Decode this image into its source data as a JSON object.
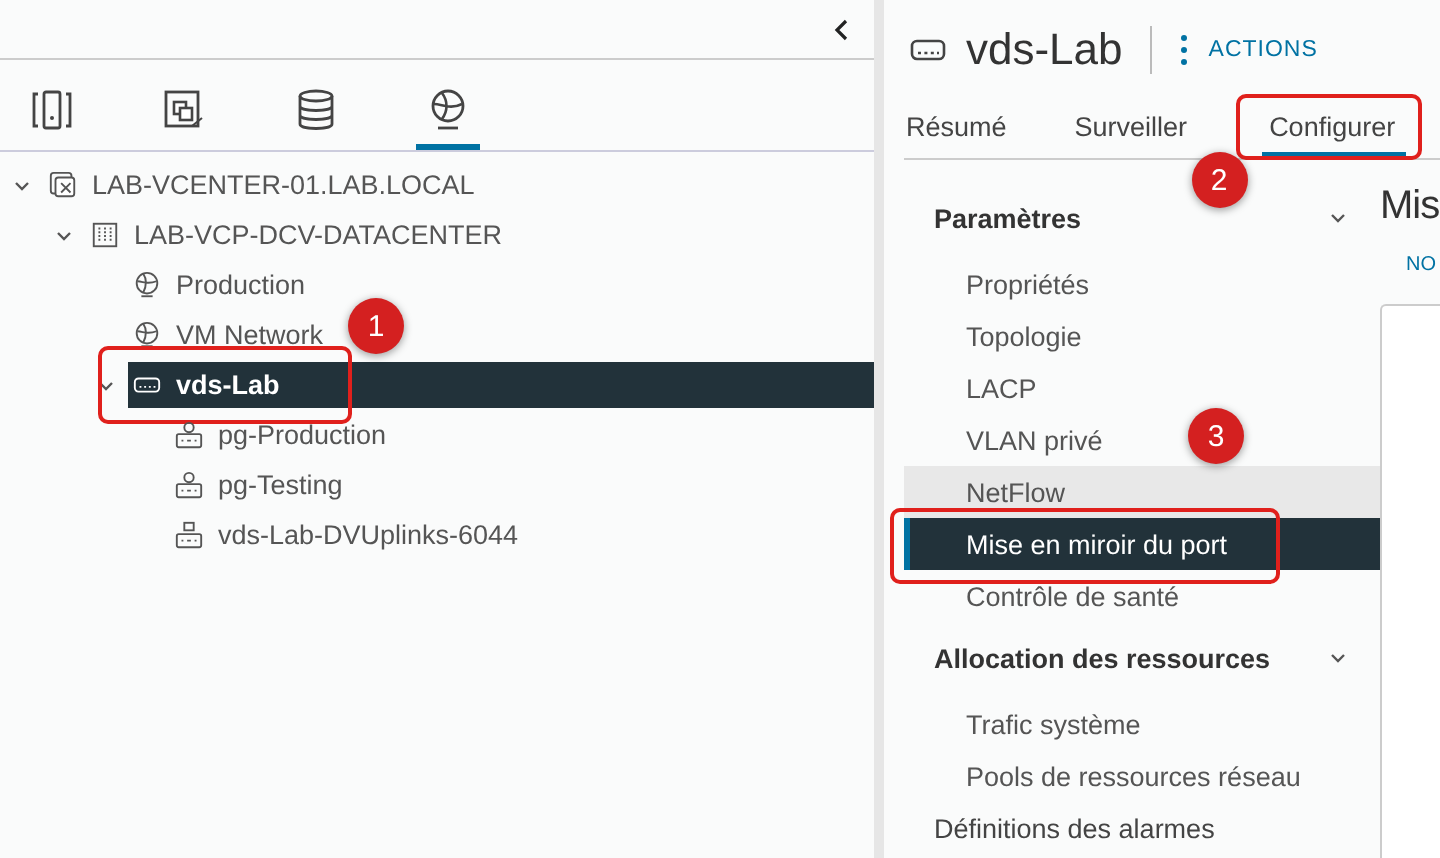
{
  "left_panel": {
    "view_tabs": [
      {
        "kind": "hosts",
        "selected": false
      },
      {
        "kind": "vms",
        "selected": false
      },
      {
        "kind": "storage",
        "selected": false
      },
      {
        "kind": "network",
        "selected": true
      }
    ],
    "tree": [
      {
        "label": "LAB-VCENTER-01.LAB.LOCAL",
        "kind": "vcenter",
        "expanded": true,
        "selected": false,
        "children": [
          {
            "label": "LAB-VCP-DCV-DATACENTER",
            "kind": "datacenter",
            "expanded": true,
            "selected": false,
            "children": [
              {
                "label": "Production",
                "kind": "network",
                "selected": false
              },
              {
                "label": "VM Network",
                "kind": "network",
                "selected": false
              },
              {
                "label": "vds-Lab",
                "kind": "vds",
                "expanded": true,
                "selected": true,
                "callout": "1",
                "children": [
                  {
                    "label": "pg-Production",
                    "kind": "portgroup",
                    "selected": false
                  },
                  {
                    "label": "pg-Testing",
                    "kind": "portgroup",
                    "selected": false
                  },
                  {
                    "label": "vds-Lab-DVUplinks-6044",
                    "kind": "uplink",
                    "selected": false
                  }
                ]
              }
            ]
          }
        ]
      }
    ]
  },
  "right_panel": {
    "title": "vds-Lab",
    "actions_label": "ACTIONS",
    "tabs": [
      {
        "label": "Résumé",
        "selected": false
      },
      {
        "label": "Surveiller",
        "selected": false
      },
      {
        "label": "Configurer",
        "selected": true,
        "callout": "2"
      }
    ],
    "nav": [
      {
        "kind": "section",
        "label": "Paramètres",
        "expanded": true,
        "items": [
          {
            "label": "Propriétés",
            "selected": false,
            "hovered": false
          },
          {
            "label": "Topologie",
            "selected": false,
            "hovered": false
          },
          {
            "label": "LACP",
            "selected": false,
            "hovered": false
          },
          {
            "label": "VLAN privé",
            "selected": false,
            "hovered": false
          },
          {
            "label": "NetFlow",
            "selected": false,
            "hovered": true
          },
          {
            "label": "Mise en miroir du port",
            "selected": true,
            "hovered": false,
            "callout": "3"
          },
          {
            "label": "Contrôle de santé",
            "selected": false,
            "hovered": false
          }
        ]
      },
      {
        "kind": "section",
        "label": "Allocation des ressources",
        "expanded": true,
        "items": [
          {
            "label": "Trafic système",
            "selected": false,
            "hovered": false
          },
          {
            "label": "Pools de ressources réseau",
            "selected": false,
            "hovered": false
          }
        ]
      },
      {
        "kind": "link",
        "label": "Définitions des alarmes"
      }
    ],
    "content": {
      "heading": "Mis",
      "tab_label": "NO"
    }
  }
}
